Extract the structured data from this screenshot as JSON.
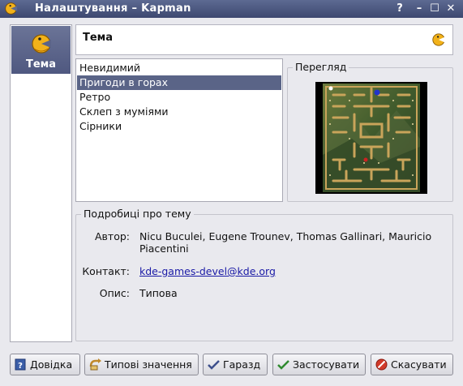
{
  "window": {
    "title": "Налаштування – Kapman",
    "help_glyph": "?",
    "min_glyph": "–",
    "max_glyph": "☐",
    "close_glyph": "✕"
  },
  "sidebar": {
    "items": [
      {
        "label": "Тема",
        "icon": "kapman-icon",
        "selected": true
      }
    ]
  },
  "header": {
    "title": "Тема",
    "icon": "kapman-icon"
  },
  "themes": {
    "items": [
      {
        "label": "Невидимий",
        "selected": false
      },
      {
        "label": "Пригоди в горах",
        "selected": true
      },
      {
        "label": "Ретро",
        "selected": false
      },
      {
        "label": "Склеп з муміями",
        "selected": false
      },
      {
        "label": "Сірники",
        "selected": false
      }
    ]
  },
  "preview": {
    "title": "Перегляд"
  },
  "details": {
    "title": "Подробиці про тему",
    "author_label": "Автор:",
    "author_value": "Nicu Buculei, Eugene Trounev, Thomas Gallinari, Mauricio Piacentini",
    "contact_label": "Контакт:",
    "contact_value": "kde-games-devel@kde.org",
    "desc_label": "Опис:",
    "desc_value": "Типова"
  },
  "buttons": {
    "help": "Довідка",
    "defaults": "Типові значення",
    "ok": "Гаразд",
    "apply": "Застосувати",
    "cancel": "Скасувати"
  },
  "colors": {
    "titlebar": "#3d4870",
    "selection": "#5a6487",
    "link": "#1a1aa6"
  }
}
